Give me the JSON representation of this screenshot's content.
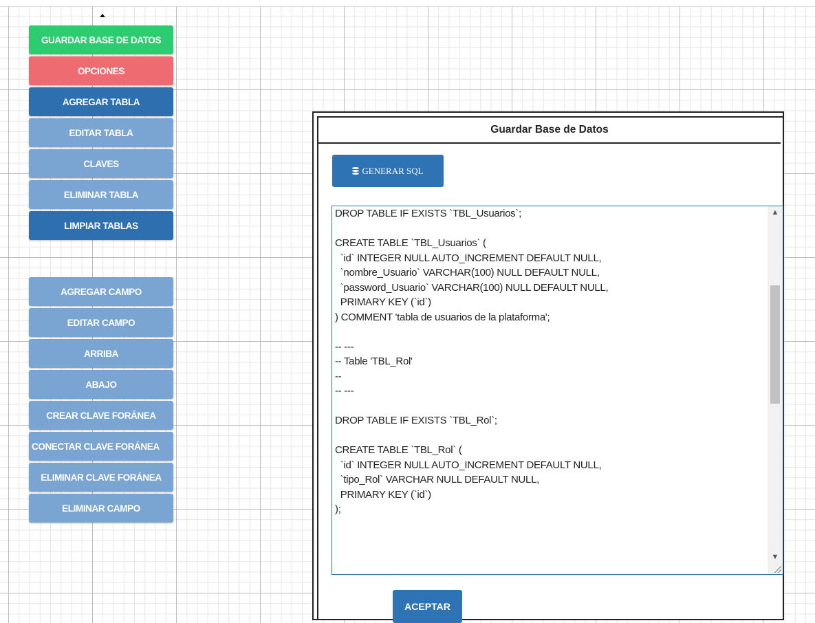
{
  "sidebar": {
    "group1": [
      {
        "label": "GUARDAR BASE DE DATOS"
      },
      {
        "label": "OPCIONES"
      },
      {
        "label": "AGREGAR TABLA"
      },
      {
        "label": "EDITAR TABLA"
      },
      {
        "label": "CLAVES"
      },
      {
        "label": "ELIMINAR TABLA"
      },
      {
        "label": "LIMPIAR TABLAS"
      }
    ],
    "group2": [
      {
        "label": "AGREGAR CAMPO"
      },
      {
        "label": "EDITAR CAMPO"
      },
      {
        "label": "ARRIBA"
      },
      {
        "label": "ABAJO"
      },
      {
        "label": "CREAR CLAVE FORÁNEA"
      },
      {
        "label": "CONECTAR CLAVE FORÁNEA"
      },
      {
        "label": "ELIMINAR CLAVE FORÁNEA"
      },
      {
        "label": "ELIMINAR CAMPO"
      }
    ]
  },
  "modal": {
    "title": "Guardar Base de Datos",
    "generate_label": "GENERAR SQL",
    "generate_icon": "database-icon",
    "sql_text": "DROP TABLE IF EXISTS `TBL_Usuarios`;\n\nCREATE TABLE `TBL_Usuarios` (\n  `id` INTEGER NULL AUTO_INCREMENT DEFAULT NULL,\n  `nombre_Usuario` VARCHAR(100) NULL DEFAULT NULL,\n  `password_Usuario` VARCHAR(100) NULL DEFAULT NULL,\n  PRIMARY KEY (`id`)\n) COMMENT 'tabla de usuarios de la plataforma';\n\n-- ---\n-- Table 'TBL_Rol'\n--\n-- ---\n\nDROP TABLE IF EXISTS `TBL_Rol`;\n\nCREATE TABLE `TBL_Rol` (\n  `id` INTEGER NULL AUTO_INCREMENT DEFAULT NULL,\n  `tipo_Rol` VARCHAR NULL DEFAULT NULL,\n  PRIMARY KEY (`id`)\n);",
    "accept_label": "ACEPTAR"
  },
  "colors": {
    "green": "#2ecc71",
    "red": "#ef6b72",
    "blue": "#2e6fb0",
    "faded_blue": "#7aa5d3"
  }
}
